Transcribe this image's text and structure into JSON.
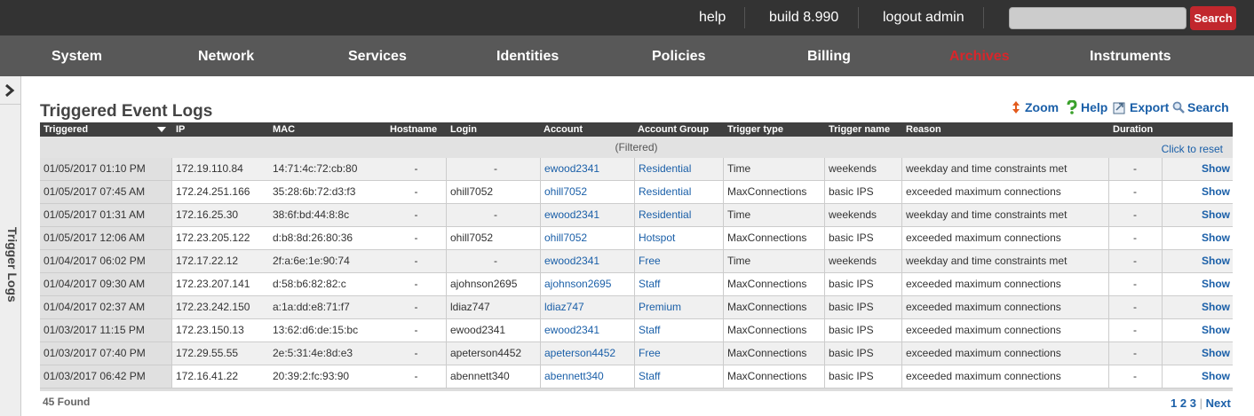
{
  "topbar": {
    "help": "help",
    "build": "build 8.990",
    "logout": "logout admin",
    "search_placeholder": "",
    "search_button": "Search"
  },
  "nav": {
    "items": [
      {
        "label": "System"
      },
      {
        "label": "Network"
      },
      {
        "label": "Services"
      },
      {
        "label": "Identities"
      },
      {
        "label": "Policies"
      },
      {
        "label": "Billing"
      },
      {
        "label": "Archives",
        "active": true
      },
      {
        "label": "Instruments"
      }
    ],
    "active_color": "#d9262b"
  },
  "sidetab": {
    "label": "Trigger Logs"
  },
  "page": {
    "title": "Triggered Event Logs",
    "tools": {
      "zoom": "Zoom",
      "help": "Help",
      "export": "Export",
      "search": "Search"
    }
  },
  "table": {
    "columns": [
      "Triggered",
      "IP",
      "MAC",
      "Hostname",
      "Login",
      "Account",
      "Account Group",
      "Trigger type",
      "Trigger name",
      "Reason",
      "Duration"
    ],
    "filtered_text": "(Filtered)",
    "reset_text": "Click to reset",
    "rows": [
      {
        "triggered": "01/05/2017 01:10 PM",
        "ip": "172.19.110.84",
        "mac": "14:71:4c:72:cb:80",
        "hostname": "-",
        "login": "-",
        "account": "ewood2341",
        "group": "Residential",
        "type": "Time",
        "name": "weekends",
        "reason": "weekday and time constraints met",
        "duration": "-",
        "action": "Show"
      },
      {
        "triggered": "01/05/2017 07:45 AM",
        "ip": "172.24.251.166",
        "mac": "35:28:6b:72:d3:f3",
        "hostname": "-",
        "login": "ohill7052",
        "account": "ohill7052",
        "group": "Residential",
        "type": "MaxConnections",
        "name": "basic IPS",
        "reason": "exceeded maximum connections",
        "duration": "-",
        "action": "Show"
      },
      {
        "triggered": "01/05/2017 01:31 AM",
        "ip": "172.16.25.30",
        "mac": "38:6f:bd:44:8:8c",
        "hostname": "-",
        "login": "-",
        "account": "ewood2341",
        "group": "Residential",
        "type": "Time",
        "name": "weekends",
        "reason": "weekday and time constraints met",
        "duration": "-",
        "action": "Show"
      },
      {
        "triggered": "01/05/2017 12:06 AM",
        "ip": "172.23.205.122",
        "mac": "d:b8:8d:26:80:36",
        "hostname": "-",
        "login": "ohill7052",
        "account": "ohill7052",
        "group": "Hotspot",
        "type": "MaxConnections",
        "name": "basic IPS",
        "reason": "exceeded maximum connections",
        "duration": "-",
        "action": "Show"
      },
      {
        "triggered": "01/04/2017 06:02 PM",
        "ip": "172.17.22.12",
        "mac": "2f:a:6e:1e:90:74",
        "hostname": "-",
        "login": "-",
        "account": "ewood2341",
        "group": "Free",
        "type": "Time",
        "name": "weekends",
        "reason": "weekday and time constraints met",
        "duration": "-",
        "action": "Show"
      },
      {
        "triggered": "01/04/2017 09:30 AM",
        "ip": "172.23.207.141",
        "mac": "d:58:b6:82:82:c",
        "hostname": "-",
        "login": "ajohnson2695",
        "account": "ajohnson2695",
        "group": "Staff",
        "type": "MaxConnections",
        "name": "basic IPS",
        "reason": "exceeded maximum connections",
        "duration": "-",
        "action": "Show"
      },
      {
        "triggered": "01/04/2017 02:37 AM",
        "ip": "172.23.242.150",
        "mac": "a:1a:dd:e8:71:f7",
        "hostname": "-",
        "login": "ldiaz747",
        "account": "ldiaz747",
        "group": "Premium",
        "type": "MaxConnections",
        "name": "basic IPS",
        "reason": "exceeded maximum connections",
        "duration": "-",
        "action": "Show"
      },
      {
        "triggered": "01/03/2017 11:15 PM",
        "ip": "172.23.150.13",
        "mac": "13:62:d6:de:15:bc",
        "hostname": "-",
        "login": "ewood2341",
        "account": "ewood2341",
        "group": "Staff",
        "type": "MaxConnections",
        "name": "basic IPS",
        "reason": "exceeded maximum connections",
        "duration": "-",
        "action": "Show"
      },
      {
        "triggered": "01/03/2017 07:40 PM",
        "ip": "172.29.55.55",
        "mac": "2e:5:31:4e:8d:e3",
        "hostname": "-",
        "login": "apeterson4452",
        "account": "apeterson4452",
        "group": "Free",
        "type": "MaxConnections",
        "name": "basic IPS",
        "reason": "exceeded maximum connections",
        "duration": "-",
        "action": "Show"
      },
      {
        "triggered": "01/03/2017 06:42 PM",
        "ip": "172.16.41.22",
        "mac": "20:39:2:fc:93:90",
        "hostname": "-",
        "login": "abennett340",
        "account": "abennett340",
        "group": "Staff",
        "type": "MaxConnections",
        "name": "basic IPS",
        "reason": "exceeded maximum connections",
        "duration": "-",
        "action": "Show"
      }
    ]
  },
  "footer": {
    "found": "45 Found",
    "pages": [
      "1",
      "2",
      "3"
    ],
    "next": "Next"
  }
}
